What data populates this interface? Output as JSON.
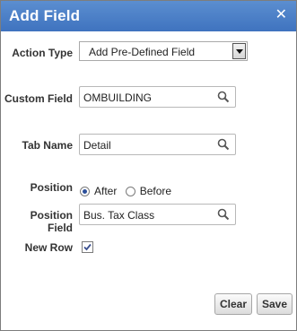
{
  "dialog": {
    "title": "Add Field",
    "close_glyph": "✕"
  },
  "form": {
    "action_type": {
      "label": "Action Type",
      "value": "Add Pre-Defined Field"
    },
    "custom_field": {
      "label": "Custom Field",
      "value": "OMBUILDING",
      "icon": "search-icon"
    },
    "tab_name": {
      "label": "Tab Name",
      "value": "Detail",
      "icon": "search-icon"
    },
    "position": {
      "label": "Position",
      "options": [
        "After",
        "Before"
      ],
      "selected": "After"
    },
    "position_field": {
      "label": "Position Field",
      "value": "Bus. Tax Class",
      "icon": "search-icon"
    },
    "new_row": {
      "label": "New Row",
      "checked": true
    }
  },
  "buttons": {
    "clear": "Clear",
    "save": "Save"
  },
  "colors": {
    "titlebar": "#4a7fc8",
    "radio_dot": "#2c4f9a",
    "check": "#3a4f8f"
  }
}
